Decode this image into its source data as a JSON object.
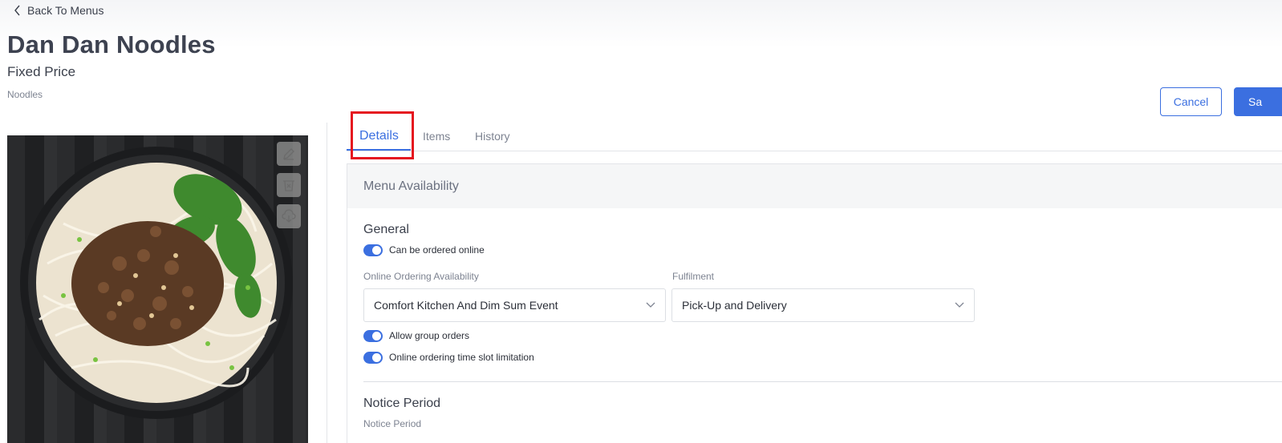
{
  "nav": {
    "back_label": "Back To Menus"
  },
  "header": {
    "title": "Dan Dan Noodles",
    "subtitle": "Fixed Price",
    "category": "Noodles"
  },
  "actions": {
    "cancel_label": "Cancel",
    "save_label": "Sa"
  },
  "tabs": [
    {
      "label": "Details",
      "active": true
    },
    {
      "label": "Items",
      "active": false
    },
    {
      "label": "History",
      "active": false
    }
  ],
  "card": {
    "header": "Menu Availability",
    "general": {
      "title": "General",
      "toggles": {
        "online": {
          "label": "Can be ordered online",
          "on": true
        },
        "group": {
          "label": "Allow group orders",
          "on": true
        },
        "timeslot": {
          "label": "Online ordering time slot limitation",
          "on": true
        }
      },
      "availability": {
        "label": "Online Ordering Availability",
        "value": "Comfort Kitchen And Dim Sum Event"
      },
      "fulfilment": {
        "label": "Fulfilment",
        "value": "Pick-Up and Delivery"
      }
    },
    "notice": {
      "title": "Notice Period",
      "label": "Notice Period"
    }
  },
  "colors": {
    "accent": "#3b6fe0",
    "highlight": "#e5161f"
  }
}
